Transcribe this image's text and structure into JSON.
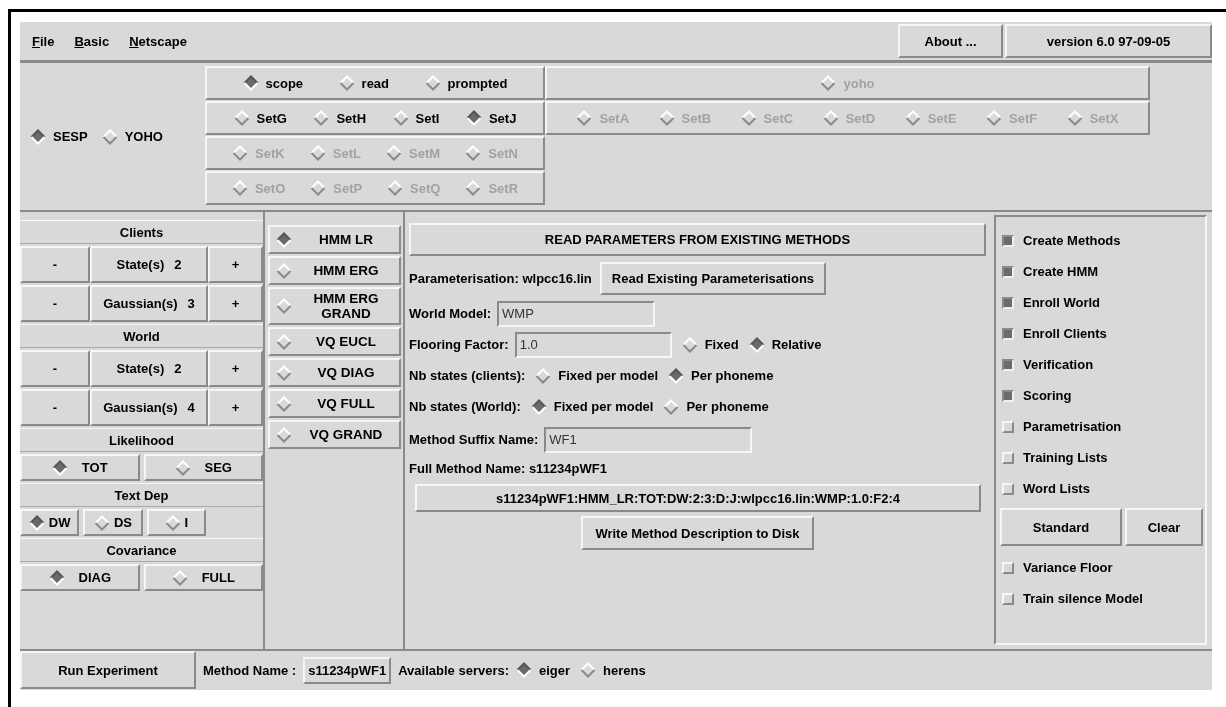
{
  "menu_bar": {
    "menus": [
      "File",
      "Basic",
      "Netscape"
    ],
    "about_button": "About ...",
    "version": "version 6.0 97-09-05"
  },
  "database": [
    {
      "label": "SESP",
      "selected": true
    },
    {
      "label": "YOHO",
      "selected": false
    }
  ],
  "sesp_rows": [
    {
      "disabled": false,
      "options": [
        {
          "label": "scope",
          "selected": true
        },
        {
          "label": "read",
          "selected": false
        },
        {
          "label": "prompted",
          "selected": false
        }
      ]
    },
    {
      "disabled": false,
      "options": [
        {
          "label": "SetG",
          "selected": false
        },
        {
          "label": "SetH",
          "selected": false
        },
        {
          "label": "SetI",
          "selected": false
        },
        {
          "label": "SetJ",
          "selected": true
        }
      ]
    },
    {
      "disabled": true,
      "options": [
        {
          "label": "SetK",
          "selected": false
        },
        {
          "label": "SetL",
          "selected": false
        },
        {
          "label": "SetM",
          "selected": false
        },
        {
          "label": "SetN",
          "selected": false
        }
      ]
    },
    {
      "disabled": true,
      "options": [
        {
          "label": "SetO",
          "selected": false
        },
        {
          "label": "SetP",
          "selected": false
        },
        {
          "label": "SetQ",
          "selected": false
        },
        {
          "label": "SetR",
          "selected": false
        }
      ]
    }
  ],
  "yoho_rows": [
    {
      "disabled": true,
      "options": [
        {
          "label": "yoho",
          "selected": false
        }
      ]
    },
    {
      "disabled": true,
      "options": [
        {
          "label": "SetA",
          "selected": false
        },
        {
          "label": "SetB",
          "selected": false
        },
        {
          "label": "SetC",
          "selected": false
        },
        {
          "label": "SetD",
          "selected": false
        },
        {
          "label": "SetE",
          "selected": false
        },
        {
          "label": "SetF",
          "selected": false
        },
        {
          "label": "SetX",
          "selected": false
        }
      ]
    }
  ],
  "left_panel": [
    {
      "kind": "heading",
      "label": "Clients"
    },
    {
      "kind": "counter",
      "minus": "-",
      "label": "State(s)",
      "value": "2",
      "plus": "+"
    },
    {
      "kind": "counter",
      "minus": "-",
      "label": "Gaussian(s)",
      "value": "3",
      "plus": "+"
    },
    {
      "kind": "heading",
      "label": "World"
    },
    {
      "kind": "counter",
      "minus": "-",
      "label": "State(s)",
      "value": "2",
      "plus": "+"
    },
    {
      "kind": "counter",
      "minus": "-",
      "label": "Gaussian(s)",
      "value": "4",
      "plus": "+"
    },
    {
      "kind": "heading",
      "label": "Likelihood"
    },
    {
      "kind": "radios",
      "options": [
        {
          "label": "TOT",
          "selected": true
        },
        {
          "label": "SEG",
          "selected": false
        }
      ]
    },
    {
      "kind": "heading",
      "label": "Text Dep"
    },
    {
      "kind": "radios",
      "options": [
        {
          "label": "DW",
          "selected": true
        },
        {
          "label": "DS",
          "selected": false
        },
        {
          "label": "I",
          "selected": false
        }
      ]
    },
    {
      "kind": "heading",
      "label": "Covariance"
    },
    {
      "kind": "radios",
      "options": [
        {
          "label": "DIAG",
          "selected": true
        },
        {
          "label": "FULL",
          "selected": false
        }
      ]
    }
  ],
  "model_types": [
    {
      "label": "HMM LR",
      "selected": true
    },
    {
      "label": "HMM ERG",
      "selected": false
    },
    {
      "label": "HMM ERG GRAND",
      "selected": false
    },
    {
      "label": "VQ EUCL",
      "selected": false
    },
    {
      "label": "VQ DIAG",
      "selected": false
    },
    {
      "label": "VQ FULL",
      "selected": false
    },
    {
      "label": "VQ GRAND",
      "selected": false
    }
  ],
  "read_methods_button": "READ PARAMETERS FROM EXISTING METHODS",
  "parameterisation": {
    "label": "Parameterisation: wlpcc16.lin",
    "button": "Read Existing Parameterisations"
  },
  "world_model": {
    "label": "World Model:",
    "value": "WMP"
  },
  "flooring_factor": {
    "label": "Flooring Factor:",
    "value": "1.0",
    "options": [
      {
        "label": "Fixed",
        "selected": false
      },
      {
        "label": "Relative",
        "selected": true
      }
    ]
  },
  "nb_states_clients": {
    "label": "Nb states (clients):",
    "options": [
      {
        "label": "Fixed per model",
        "selected": false
      },
      {
        "label": "Per phoneme",
        "selected": true
      }
    ]
  },
  "nb_states_world": {
    "label": "Nb states (World):",
    "options": [
      {
        "label": "Fixed per model",
        "selected": true
      },
      {
        "label": "Per phoneme",
        "selected": false
      }
    ]
  },
  "method_suffix": {
    "label": "Method Suffix Name:",
    "value": "WF1"
  },
  "full_method_name": "Full Method Name: s11234pWF1",
  "method_description": "s11234pWF1:HMM_LR:TOT:DW:2:3:D:J:wlpcc16.lin:WMP:1.0:F2:4",
  "write_button": "Write Method Description to Disk",
  "steps": [
    {
      "label": "Create Methods",
      "checked": true
    },
    {
      "label": "Create HMM",
      "checked": true
    },
    {
      "label": "Enroll World",
      "checked": true
    },
    {
      "label": "Enroll Clients",
      "checked": true
    },
    {
      "label": "Verification",
      "checked": true
    },
    {
      "label": "Scoring",
      "checked": true
    },
    {
      "label": "Parametrisation",
      "checked": false
    },
    {
      "label": "Training Lists",
      "checked": false
    },
    {
      "label": "Word Lists",
      "checked": false
    }
  ],
  "standard_button": "Standard",
  "clear_button": "Clear",
  "extras": [
    {
      "label": "Variance Floor",
      "checked": false
    },
    {
      "label": "Train silence Model",
      "checked": false
    }
  ],
  "bottom_bar": {
    "run_button": "Run Experiment",
    "method_name_label": "Method Name :",
    "method_name": "s11234pWF1",
    "servers_label": "Available servers:",
    "servers": [
      {
        "label": "eiger",
        "selected": true
      },
      {
        "label": "herens",
        "selected": false
      }
    ]
  }
}
